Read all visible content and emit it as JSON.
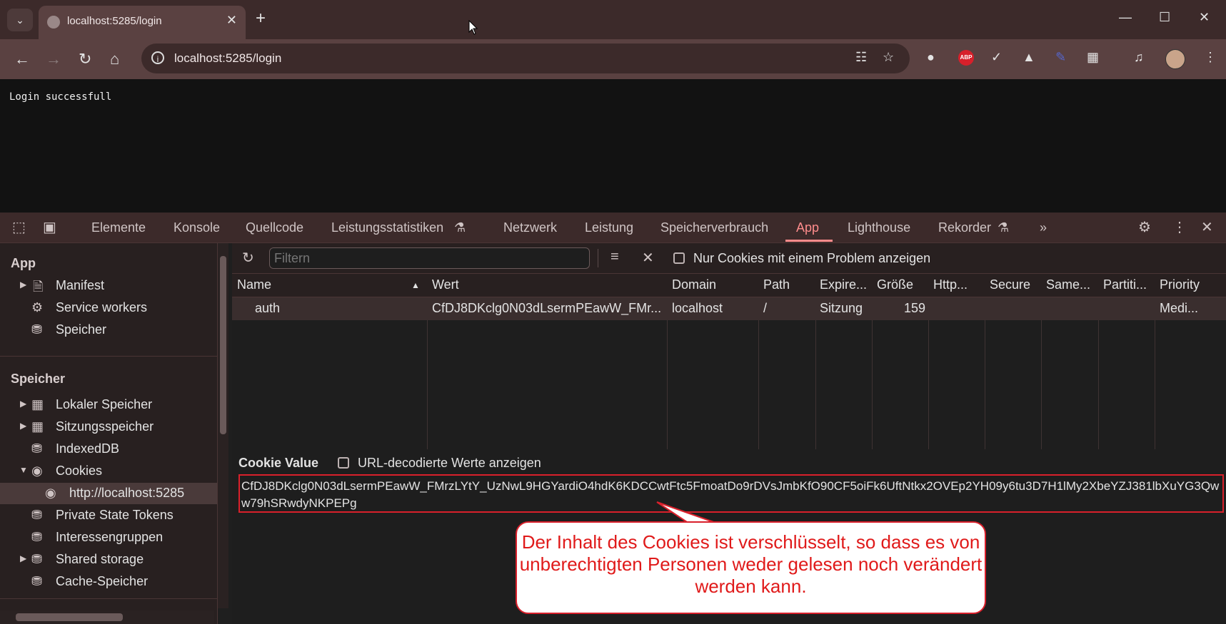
{
  "browser": {
    "tab_title": "localhost:5285/login",
    "url": "localhost:5285/login",
    "new_tab": "+",
    "abp_label": "ABP"
  },
  "page": {
    "text": "Login successfull"
  },
  "devtools": {
    "tabs": [
      "Elemente",
      "Konsole",
      "Quellcode",
      "Leistungsstatistiken",
      "Netzwerk",
      "Leistung",
      "Speicherverbrauch",
      "App",
      "Lighthouse",
      "Rekorder"
    ],
    "active_tab": "App",
    "sidebar": {
      "app_header": "App",
      "app_items": [
        "Manifest",
        "Service workers",
        "Speicher"
      ],
      "storage_header": "Speicher",
      "storage_items": [
        "Lokaler Speicher",
        "Sitzungsspeicher",
        "IndexedDB",
        "Cookies",
        "http://localhost:5285",
        "Private State Tokens",
        "Interessengruppen",
        "Shared storage",
        "Cache-Speicher"
      ]
    },
    "filter": {
      "placeholder": "Filtern",
      "problem_checkbox_label": "Nur Cookies mit einem Problem anzeigen"
    },
    "table": {
      "columns": [
        "Name",
        "Wert",
        "Domain",
        "Path",
        "Expire...",
        "Größe",
        "Http...",
        "Secure",
        "Same...",
        "Partiti...",
        "Priority"
      ],
      "rows": [
        {
          "name": "auth",
          "value": "CfDJ8DKclg0N03dLsermPEawW_FMr...",
          "domain": "localhost",
          "path": "/",
          "expires": "Sitzung",
          "size": "159",
          "http": "",
          "secure": "",
          "same": "",
          "partition": "",
          "priority": "Medi..."
        }
      ]
    },
    "cookie_value": {
      "title": "Cookie Value",
      "decode_label": "URL-decodierte Werte anzeigen",
      "value": "CfDJ8DKclg0N03dLsermPEawW_FMrzLYtY_UzNwL9HGYardiO4hdK6KDCCwtFtc5FmoatDo9rDVsJmbKfO90CF5oiFk6UftNtkx2OVEp2YH09y6tu3D7H1lMy2XbeYZJ381lbXuYG3Qww79hSRwdyNKPEPg"
    }
  },
  "callout": {
    "text": "Der Inhalt des Cookies ist verschlüsselt, so dass es von unberechtigten Personen weder gelesen noch verändert werden kann."
  },
  "colors": {
    "accent": "#ff8c8c",
    "callout_border": "#d9202b",
    "callout_text": "#e01a1a"
  }
}
